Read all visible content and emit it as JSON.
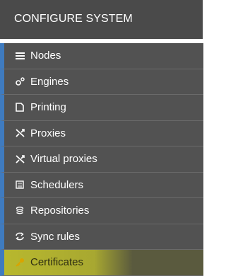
{
  "header": {
    "title": "CONFIGURE SYSTEM"
  },
  "menu": {
    "items": [
      {
        "label": "Nodes",
        "icon": "nodes-icon"
      },
      {
        "label": "Engines",
        "icon": "engines-icon"
      },
      {
        "label": "Printing",
        "icon": "printing-icon"
      },
      {
        "label": "Proxies",
        "icon": "proxies-icon"
      },
      {
        "label": "Virtual proxies",
        "icon": "virtual-proxies-icon"
      },
      {
        "label": "Schedulers",
        "icon": "schedulers-icon"
      },
      {
        "label": "Repositories",
        "icon": "repositories-icon"
      },
      {
        "label": "Sync rules",
        "icon": "sync-rules-icon"
      },
      {
        "label": "Certificates",
        "icon": "certificates-icon",
        "selected": true
      }
    ]
  },
  "colors": {
    "header_bg": "#4a4a4a",
    "item_bg": "#525252",
    "accent_bar": "#3f7bbf",
    "highlight": "#dcdc28"
  }
}
